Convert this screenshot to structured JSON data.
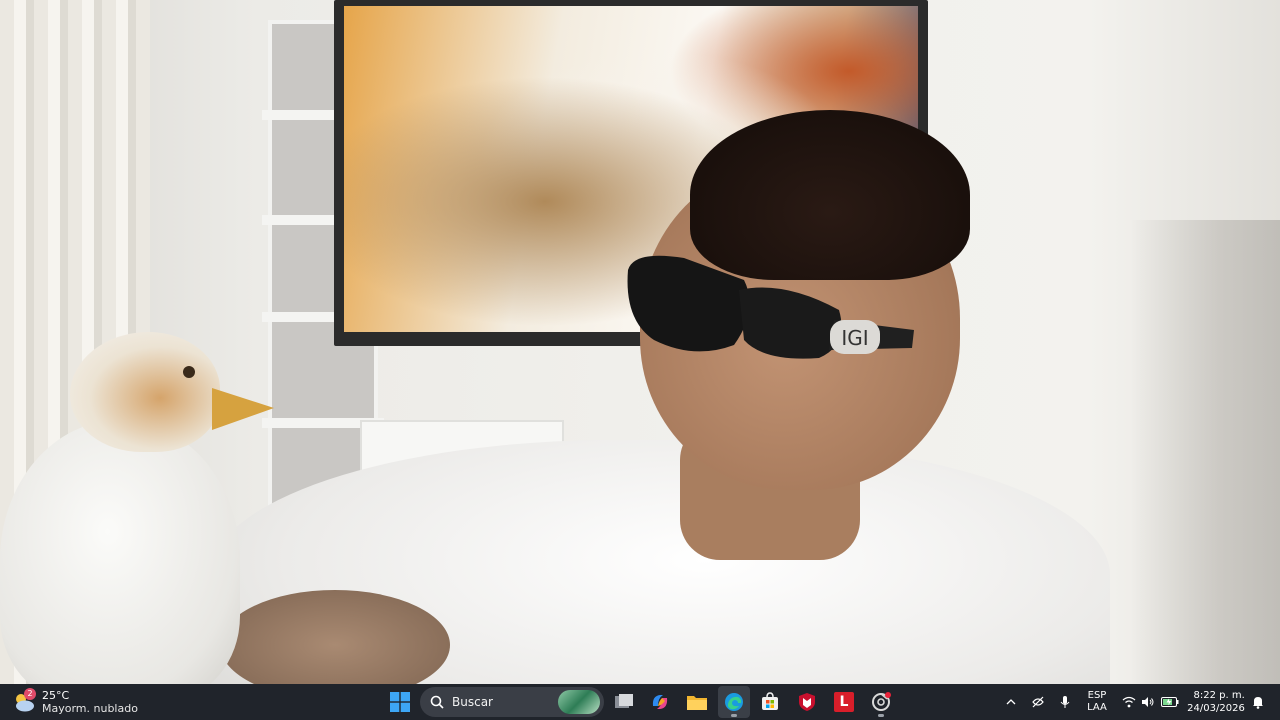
{
  "taskbar": {
    "weather": {
      "temperature": "25°C",
      "condition": "Mayorm. nublado",
      "badge": "2",
      "icon": "partly-cloudy-icon"
    },
    "search": {
      "placeholder": "Buscar",
      "icon": "search-icon"
    },
    "apps": [
      {
        "name": "start-button",
        "icon": "windows-logo-icon"
      },
      {
        "name": "task-view-button",
        "icon": "task-view-icon"
      },
      {
        "name": "copilot-button",
        "icon": "copilot-icon"
      },
      {
        "name": "file-explorer-button",
        "icon": "folder-icon"
      },
      {
        "name": "edge-button",
        "icon": "edge-icon"
      },
      {
        "name": "store-button",
        "icon": "store-icon"
      },
      {
        "name": "mcafee-button",
        "icon": "mcafee-shield-icon"
      },
      {
        "name": "l-app-button",
        "icon": "letter-l-icon",
        "label": "L"
      },
      {
        "name": "chrome-button",
        "icon": "chrome-icon"
      }
    ],
    "tray": {
      "language_top": "ESP",
      "language_bottom": "LAA",
      "time": "8:22 p. m.",
      "date": "24/03/2026"
    },
    "colors": {
      "taskbar_bg": "#20242b",
      "accent": "#0078d4"
    }
  }
}
